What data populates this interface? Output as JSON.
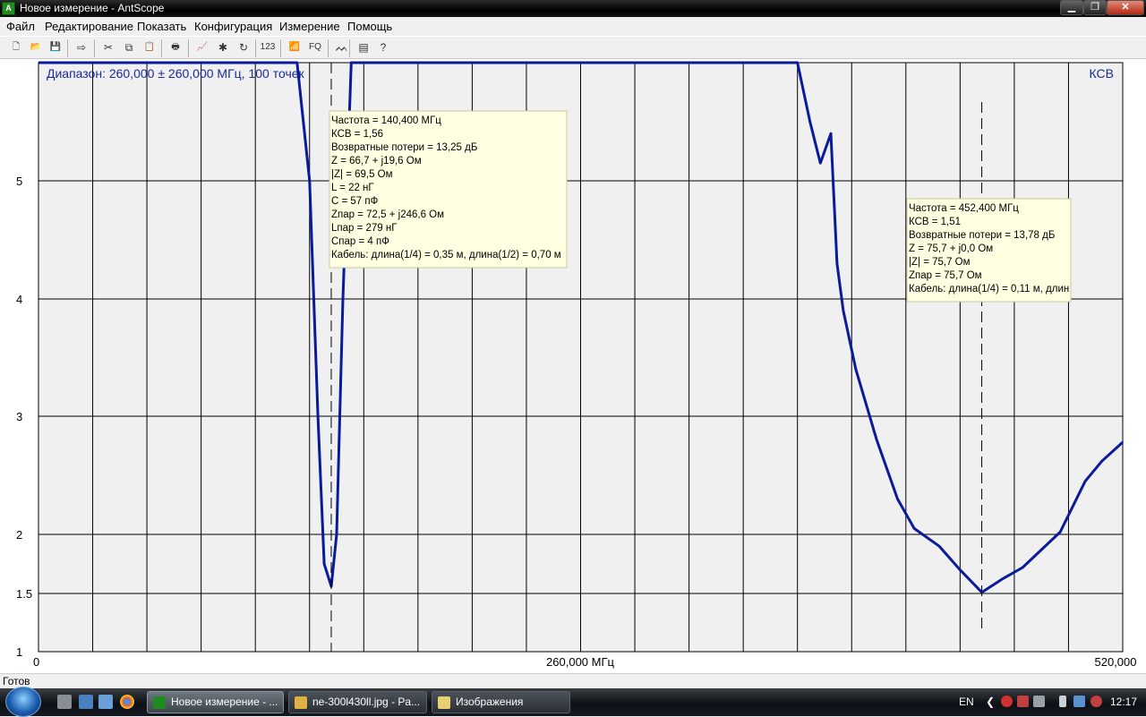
{
  "window": {
    "title": "Новое измерение - AntScope"
  },
  "menu": [
    "Файл",
    "Редактирование",
    "Показать",
    "Конфигурация",
    "Измерение",
    "Помощь"
  ],
  "toolbar": [
    {
      "icon": "new-file-icon",
      "glyph": "🗋"
    },
    {
      "icon": "open-folder-icon",
      "glyph": "📂"
    },
    {
      "icon": "save-icon",
      "glyph": "💾"
    },
    {
      "icon": "export-icon",
      "glyph": "⇨"
    },
    {
      "icon": "cut-icon",
      "glyph": "✂"
    },
    {
      "icon": "copy-icon",
      "glyph": "⧉"
    },
    {
      "icon": "paste-icon",
      "glyph": "📋"
    },
    {
      "icon": "print-icon",
      "glyph": "🖶"
    },
    {
      "icon": "chart-icon",
      "glyph": "📈"
    },
    {
      "icon": "settings-icon",
      "glyph": "✱"
    },
    {
      "icon": "refresh-icon",
      "glyph": "↻"
    },
    {
      "icon": "numeric-icon",
      "glyph": "123"
    },
    {
      "icon": "antenna-icon",
      "glyph": "📶"
    },
    {
      "icon": "fq-icon",
      "glyph": "FQ"
    },
    {
      "icon": "waveform-icon",
      "glyph": "ᨓ"
    },
    {
      "icon": "document-icon",
      "glyph": "▤"
    },
    {
      "icon": "help-icon",
      "glyph": "?"
    }
  ],
  "chart": {
    "range_label": "Диапазон: 260,000 ± 260,000 МГц, 100 точек",
    "mode_label": "КСВ",
    "x_label": "260,000 МГц",
    "x_ticks": [
      "0",
      "260,000 МГц",
      "520,000"
    ],
    "y_ticks": [
      "1",
      "1.5",
      "2",
      "3",
      "4",
      "5"
    ],
    "line_color": "#0a1a9a",
    "grid_color": "#000000",
    "bg_color": "#f0f0f0"
  },
  "chart_data": {
    "type": "line",
    "title": "Диапазон: 260,000 ± 260,000 МГц, 100 точек",
    "ylabel": "КСВ",
    "xlabel": "МГц",
    "xlim": [
      0,
      520
    ],
    "ylim": [
      1,
      6
    ],
    "y_scale": "nonlinear",
    "grid": true,
    "series": [
      {
        "name": "КСВ",
        "x": [
          0,
          124,
          130,
          134,
          137,
          140.4,
          143,
          146,
          150,
          156,
          162,
          200,
          260,
          300,
          364,
          370,
          375,
          380,
          383,
          386,
          392,
          402,
          412,
          420,
          432,
          442,
          452.4,
          462,
          472,
          490,
          502,
          510,
          520
        ],
        "y": [
          6,
          6,
          5.0,
          3.0,
          1.75,
          1.56,
          2.0,
          4.0,
          6,
          6,
          6,
          6,
          6,
          6,
          6,
          5.5,
          5.15,
          5.4,
          4.3,
          3.9,
          3.4,
          2.8,
          2.3,
          2.05,
          1.9,
          1.7,
          1.51,
          1.62,
          1.72,
          2.02,
          2.45,
          2.62,
          2.78
        ]
      }
    ],
    "markers": [
      {
        "x": 140.4,
        "lines": [
          "Частота = 140,400 МГц",
          "КСВ = 1,56",
          "Возвратные потери = 13,25 дБ",
          "Z = 66,7 + j19,6 Ом",
          "|Z| = 69,5 Ом",
          "L = 22 нГ",
          "C = 57 пФ",
          "Zпар = 72,5 + j246,6 Ом",
          "Lпар = 279 нГ",
          "Cпар = 4 пФ",
          "Кабель: длина(1/4) = 0,35 м, длина(1/2) = 0,70 м"
        ]
      },
      {
        "x": 452.4,
        "lines": [
          "Частота = 452,400 МГц",
          "КСВ = 1,51",
          "Возвратные потери = 13,78 дБ",
          "Z = 75,7 + j0,0 Ом",
          "|Z| = 75,7 Ом",
          "Zпар = 75,7 Ом",
          "Кабель: длина(1/4) = 0,11 м, длин"
        ]
      }
    ]
  },
  "status": {
    "text": "Готов"
  },
  "taskbar": {
    "tasks": [
      {
        "label": "Новое измерение - ...",
        "active": true
      },
      {
        "label": "ne-300l430ll.jpg - Pa...",
        "active": false
      },
      {
        "label": "Изображения",
        "active": false
      }
    ],
    "lang": "EN",
    "clock": "12:17"
  }
}
